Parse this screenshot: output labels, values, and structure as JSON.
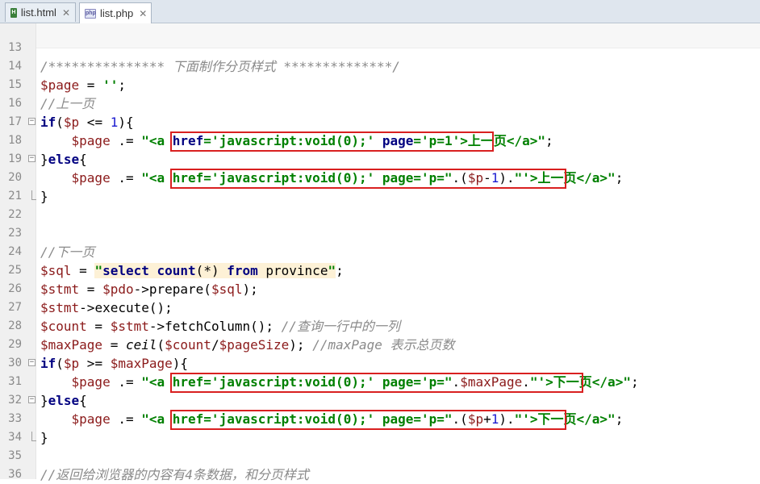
{
  "tabs": [
    {
      "label": "list.html",
      "icon": "html-file-icon",
      "active": false
    },
    {
      "label": "list.php",
      "icon": "php-file-icon",
      "active": true
    }
  ],
  "editor": {
    "lines": [
      {
        "num": "13",
        "html": ""
      },
      {
        "num": "14",
        "html": "<span class=\"cm\">/*************** 下面制作分页样式 **************/</span>"
      },
      {
        "num": "15",
        "html": "<span class=\"v\">$page</span> = <span class=\"s\">''</span>;"
      },
      {
        "num": "16",
        "html": "<span class=\"cm\">//上一页</span>"
      },
      {
        "num": "17",
        "fold": "open",
        "html": "<span class=\"k\">if</span>(<span class=\"v\">$p</span> &lt;= <span class=\"n\">1</span>){"
      },
      {
        "num": "18",
        "html": "    <span class=\"v\">$page</span> .= <span class=\"s\">\"&lt;a </span><span class=\"k\">href</span><span class=\"s\">=</span><span class=\"s\">'javascript:void(0);'</span> <span class=\"k\">page</span><span class=\"s\">=</span><span class=\"s\">'p=1'</span><span class=\"s\">&gt;上一页&lt;/a&gt;\"</span>;"
      },
      {
        "num": "19",
        "fold": "mid",
        "html": "}<span class=\"k\">else</span>{"
      },
      {
        "num": "20",
        "html": "    <span class=\"v\">$page</span> .= <span class=\"s\">\"&lt;a href='javascript:void(0);' page='p=\"</span>.(<span class=\"v\">$p</span>-<span class=\"n\">1</span>).<span class=\"s\">\"'&gt;上一页&lt;/a&gt;\"</span>;"
      },
      {
        "num": "21",
        "fold": "end",
        "html": "}"
      },
      {
        "num": "22",
        "html": ""
      },
      {
        "num": "23",
        "html": ""
      },
      {
        "num": "24",
        "html": "<span class=\"cm\">//下一页</span>"
      },
      {
        "num": "25",
        "html": "<span class=\"v\">$sql</span> = <span class=\"sq\"><span class=\"s\">\"</span><span class=\"k\">select count</span>(<span class=\"f\">*</span>) <span class=\"k\">from</span> province<span class=\"s\">\"</span></span>;"
      },
      {
        "num": "26",
        "html": "<span class=\"v\">$stmt</span> = <span class=\"v\">$pdo</span>-&gt;prepare(<span class=\"v\">$sql</span>);"
      },
      {
        "num": "27",
        "html": "<span class=\"v\">$stmt</span>-&gt;execute();"
      },
      {
        "num": "28",
        "html": "<span class=\"v\">$count</span> = <span class=\"v\">$stmt</span>-&gt;fetchColumn(); <span class=\"cm\">//查询一行中的一列</span>"
      },
      {
        "num": "29",
        "html": "<span class=\"v\">$maxPage</span> = <span class=\"f\">ceil</span>(<span class=\"v\">$count</span>/<span class=\"v\">$pageSize</span>); <span class=\"cm\">//maxPage 表示总页数</span>"
      },
      {
        "num": "30",
        "fold": "open",
        "html": "<span class=\"k\">if</span>(<span class=\"v\">$p</span> &gt;= <span class=\"v\">$maxPage</span>){"
      },
      {
        "num": "31",
        "html": "    <span class=\"v\">$page</span> .= <span class=\"s\">\"&lt;a href='javascript:void(0);' page='p=\"</span>.<span class=\"v\">$maxPage</span>.<span class=\"s\">\"'&gt;下一页&lt;/a&gt;\"</span>;"
      },
      {
        "num": "32",
        "fold": "mid",
        "html": "}<span class=\"k\">else</span>{"
      },
      {
        "num": "33",
        "html": "    <span class=\"v\">$page</span> .= <span class=\"s\">\"&lt;a href='javascript:void(0);' page='p=\"</span>.(<span class=\"v\">$p</span>+<span class=\"n\">1</span>).<span class=\"s\">\"'&gt;下一页&lt;/a&gt;\"</span>;"
      },
      {
        "num": "34",
        "fold": "end",
        "html": "}"
      },
      {
        "num": "35",
        "html": ""
      },
      {
        "num": "36",
        "html": "<span class=\"cm\">//返回给浏览器的内容有4条数据，和分页样式</span>"
      }
    ]
  },
  "colors": {
    "highlight_box": "#d92020",
    "string": "#008000",
    "keyword": "#000080",
    "variable": "#8b1a1a",
    "comment": "#8a8a8a"
  }
}
